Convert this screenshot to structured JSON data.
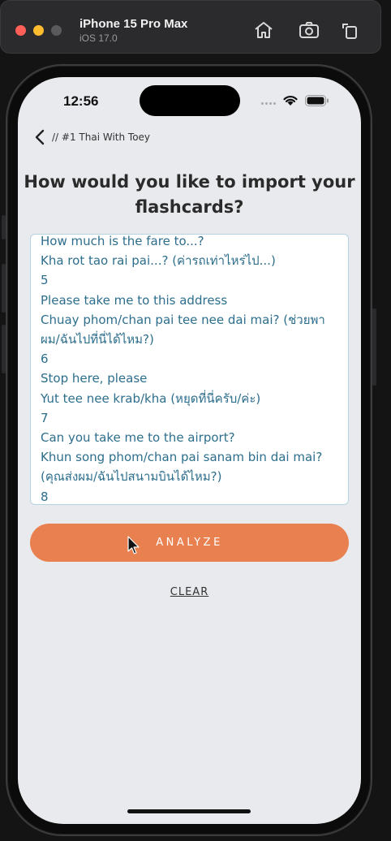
{
  "simulator": {
    "device_name": "iPhone 15 Pro Max",
    "os_version": "iOS 17.0",
    "toolbar_icons": [
      "home-icon",
      "screenshot-icon",
      "rotate-icon"
    ]
  },
  "status_bar": {
    "time": "12:56",
    "icons": [
      "signal-dots-icon",
      "wifi-icon",
      "battery-icon"
    ]
  },
  "nav": {
    "back_icon": "chevron-left-icon",
    "title": "// #1 Thai With Toey"
  },
  "heading": "How would you like to import your flashcards?",
  "import_box": {
    "text": "How much is the fare to...?\nKha rot tao rai pai...? (ค่ารถเท่าไหร่ไป...)\n5\nPlease take me to this address\nChuay phom/chan pai tee nee dai mai? (ช่วยพาผม/ฉันไปที่นี่ได้ไหม?)\n6\nStop here, please\nYut tee nee krab/kha (หยุดที่นี่ครับ/ค่ะ)\n7\nCan you take me to the airport?\nKhun song phom/chan pai sanam bin dai mai? (คุณส่งผม/ฉันไปสนามบินได้ไหม?)\n8"
  },
  "buttons": {
    "analyze": "ANALYZE",
    "clear": "CLEAR"
  },
  "colors": {
    "accent": "#e8804f",
    "text_teal": "#2d6e8c",
    "box_border": "#b7d3df",
    "screen_bg": "#e9eaed"
  }
}
